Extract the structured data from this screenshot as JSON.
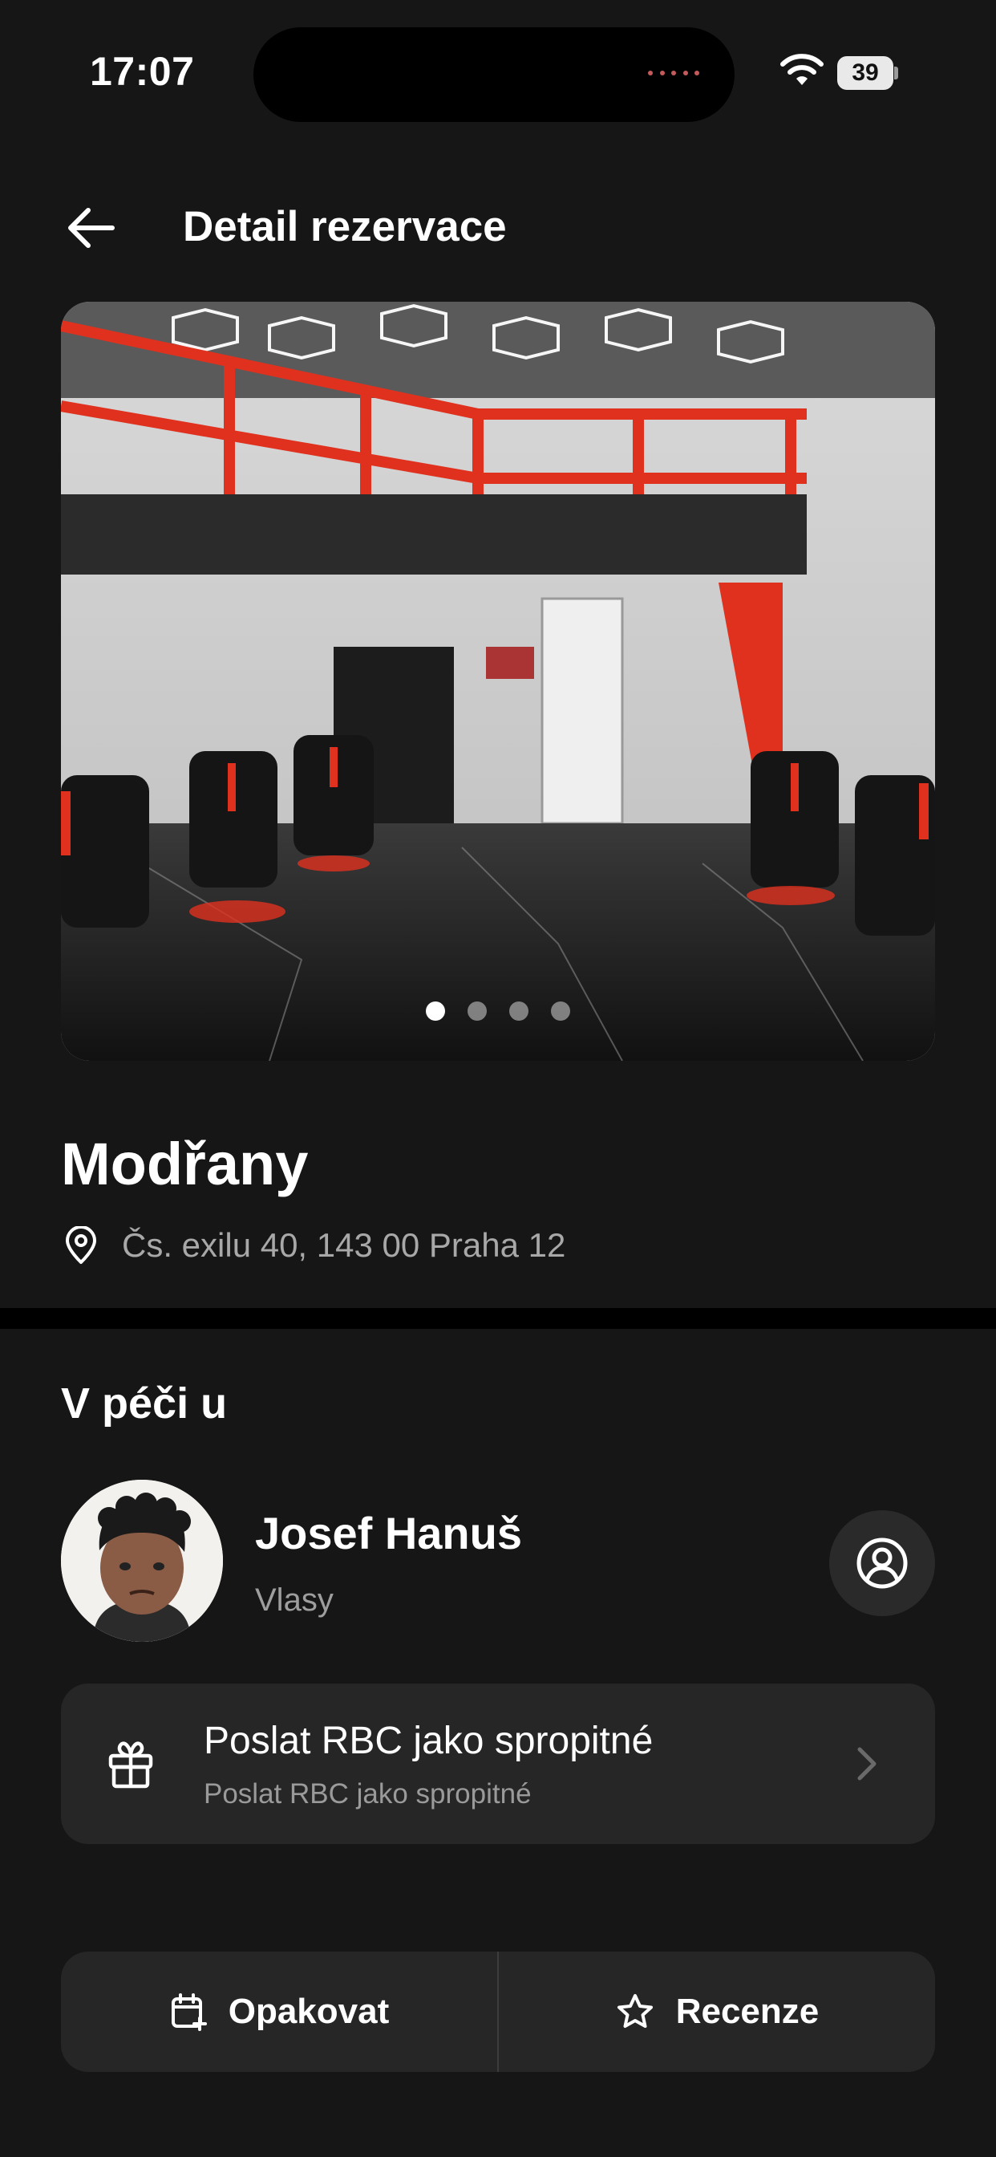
{
  "status_bar": {
    "time": "17:07",
    "battery": "39"
  },
  "header": {
    "title": "Detail rezervace"
  },
  "gallery": {
    "photo_count": 4,
    "active_index": 0
  },
  "location": {
    "name": "Modřany",
    "address": "Čs. exilu 40, 143 00 Praha 12"
  },
  "care": {
    "section_title": "V péči u",
    "barber_name": "Josef Hanuš",
    "barber_role": "Vlasy"
  },
  "tip": {
    "title": "Poslat RBC jako spropitné",
    "subtitle": "Poslat RBC jako spropitné"
  },
  "actions": {
    "repeat_label": "Opakovat",
    "review_label": "Recenze"
  },
  "icons": [
    "back-arrow-icon",
    "wifi-icon",
    "battery-icon",
    "location-pin-icon",
    "user-circle-icon",
    "gift-icon",
    "chevron-right-icon",
    "calendar-plus-icon",
    "star-icon"
  ],
  "colors": {
    "background": "#161616",
    "card": "#262626",
    "text_secondary": "#a8a8a8",
    "accent_red": "#e0311f"
  }
}
